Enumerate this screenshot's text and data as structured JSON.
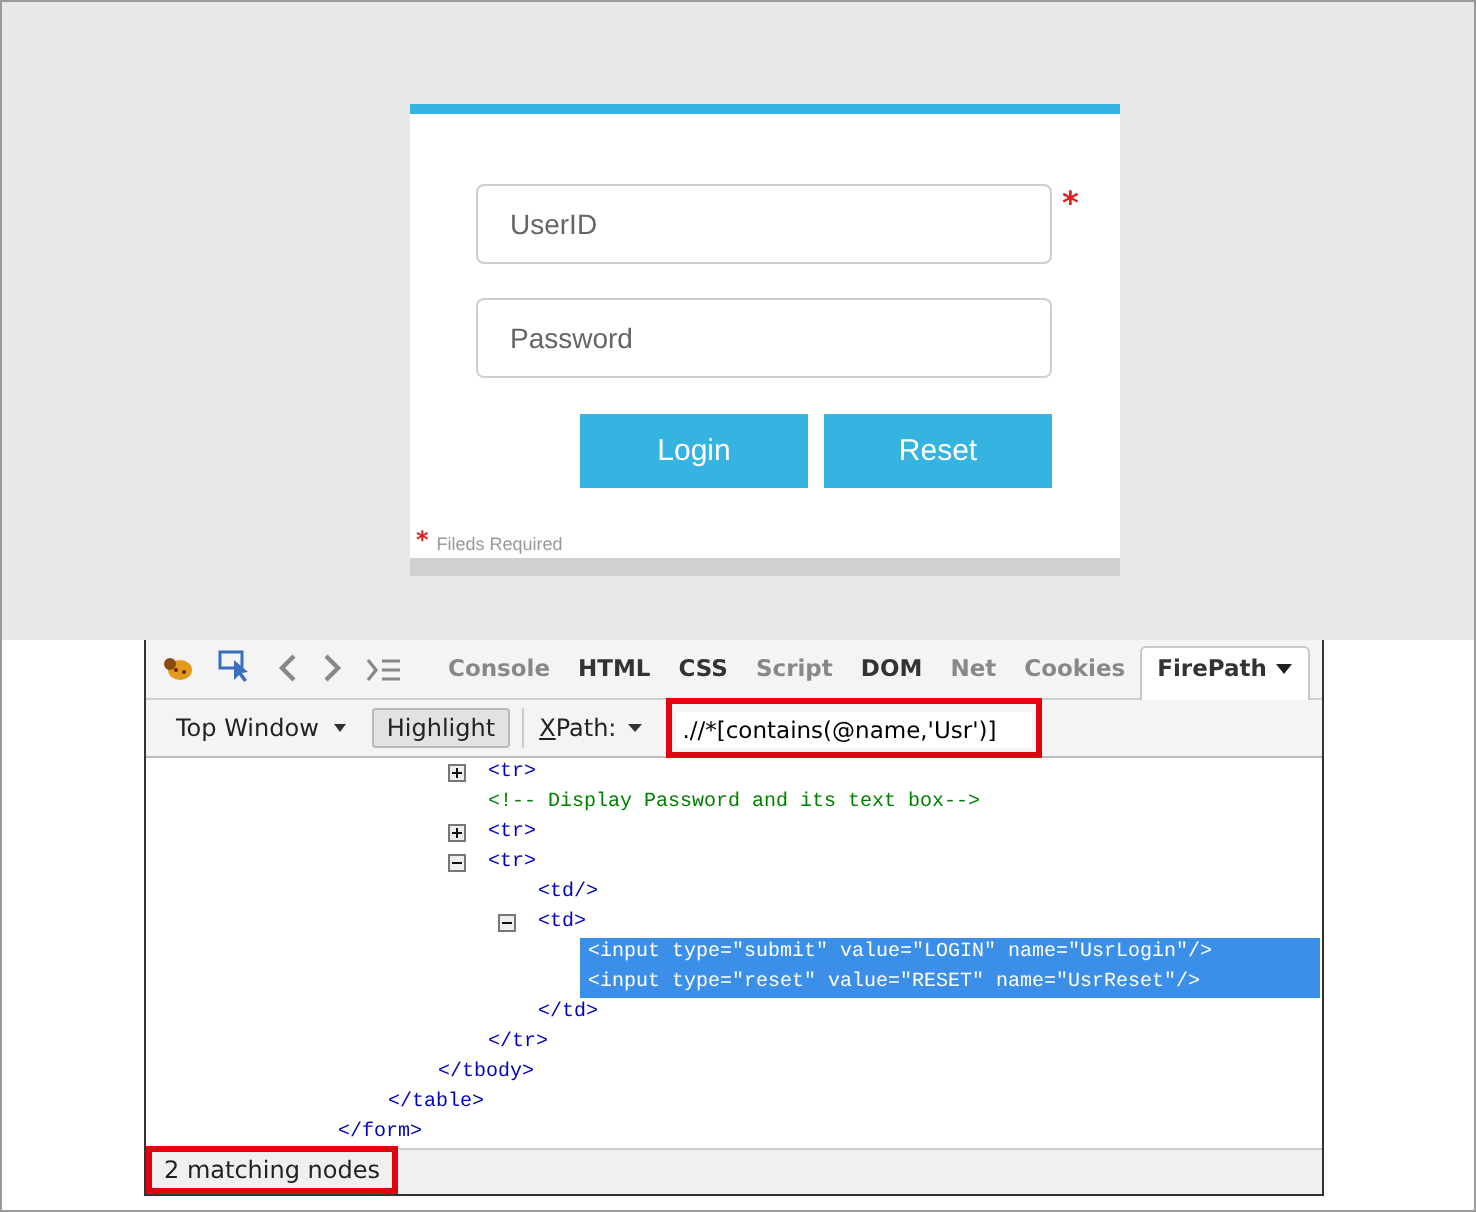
{
  "login": {
    "fields": [
      {
        "placeholder": "UserID",
        "mark": "*"
      },
      {
        "placeholder": "Password"
      }
    ],
    "buttons": [
      "Login",
      "Reset"
    ],
    "footnote": {
      "mark": "*",
      "text": "Fileds Required"
    }
  },
  "devtools": {
    "tabs": [
      {
        "label": "Console",
        "disabled": true,
        "selected": false
      },
      {
        "label": "HTML",
        "disabled": false,
        "selected": false
      },
      {
        "label": "CSS",
        "disabled": false,
        "selected": false
      },
      {
        "label": "Script",
        "disabled": true,
        "selected": false
      },
      {
        "label": "DOM",
        "disabled": false,
        "selected": false
      },
      {
        "label": "Net",
        "disabled": true,
        "selected": false
      },
      {
        "label": "Cookies",
        "disabled": true,
        "selected": false
      },
      {
        "label": "FirePath",
        "disabled": false,
        "selected": true
      }
    ],
    "toolbar": {
      "window_menu": "Top Window",
      "highlight_button": "Highlight",
      "highlight_on": true,
      "xpath_label": "XPath:",
      "xpath_value": ".//*[contains(@name,'Usr')]"
    },
    "tree": [
      {
        "close": "</form>",
        "children": [
          {
            "close": "</table>",
            "children": [
              {
                "close": "</tbody>",
                "children": [
                  {
                    "text": "<tr>",
                    "kind": "tag",
                    "expanded": false
                  },
                  {
                    "text": "<!-- Display Password and its text box-->",
                    "kind": "comment"
                  },
                  {
                    "text": "<tr>",
                    "kind": "tag",
                    "expanded": false
                  },
                  {
                    "text": "<tr>",
                    "kind": "tag",
                    "expanded": true,
                    "close": "</tr>",
                    "children": [
                      {
                        "text": "<td/>",
                        "kind": "tag"
                      },
                      {
                        "text": "<td>",
                        "kind": "tag",
                        "expanded": true,
                        "close": "</td>",
                        "children": [
                          {
                            "text": "<input type=\"submit\" value=\"LOGIN\" name=\"UsrLogin\"/>",
                            "kind": "tag",
                            "selected": true
                          },
                          {
                            "text": "<input type=\"reset\" value=\"RESET\" name=\"UsrReset\"/>",
                            "kind": "tag",
                            "selected": true
                          }
                        ]
                      }
                    ]
                  }
                ]
              }
            ]
          }
        ]
      }
    ],
    "status": "2 matching nodes"
  }
}
